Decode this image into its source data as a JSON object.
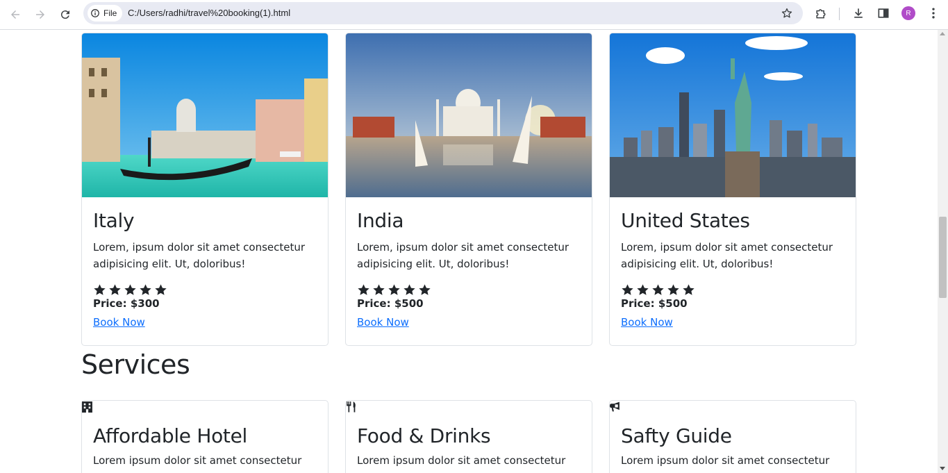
{
  "browser": {
    "site_chip": "File",
    "url": "C:/Users/radhi/travel%20booking(1).html",
    "profile_initial": "R",
    "icons": [
      "back-icon",
      "forward-icon",
      "reload-icon",
      "info-icon",
      "bookmark-star-icon",
      "extensions-icon",
      "download-icon",
      "side-panel-icon",
      "menu-icon"
    ]
  },
  "destinations": [
    {
      "title": "Italy",
      "text": "Lorem, ipsum dolor sit amet consectetur adipisicing elit. Ut, doloribus!",
      "rating": 5,
      "price": "Price: $300",
      "link": "Book Now"
    },
    {
      "title": "India",
      "text": "Lorem, ipsum dolor sit amet consectetur adipisicing elit. Ut, doloribus!",
      "rating": 5,
      "price": "Price: $500",
      "link": "Book Now"
    },
    {
      "title": "United States",
      "text": "Lorem, ipsum dolor sit amet consectetur adipisicing elit. Ut, doloribus!",
      "rating": 5,
      "price": "Price: $500",
      "link": "Book Now"
    }
  ],
  "services": {
    "heading": "Services",
    "items": [
      {
        "icon": "hotel-icon",
        "title": "Affordable Hotel",
        "text": "Lorem ipsum dolor sit amet consectetur"
      },
      {
        "icon": "utensils-icon",
        "title": "Food & Drinks",
        "text": "Lorem ipsum dolor sit amet consectetur"
      },
      {
        "icon": "bullhorn-icon",
        "title": "Safty Guide",
        "text": "Lorem ipsum dolor sit amet consectetur"
      }
    ]
  },
  "colors": {
    "link": "#0d6efd",
    "text": "#212529",
    "border": "#dee2e6"
  }
}
